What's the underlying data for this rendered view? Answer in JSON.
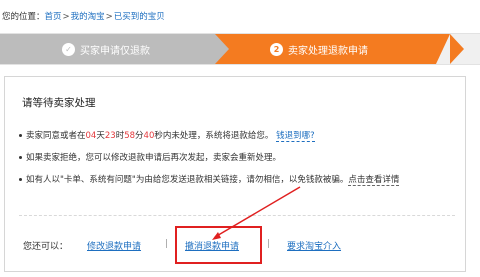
{
  "breadcrumb": {
    "prefix": "您的位置：",
    "items": [
      "首页",
      "我的淘宝",
      "已买到的宝贝"
    ],
    "separator": ">"
  },
  "steps": [
    {
      "label": "买家申请仅退款",
      "icon": "✓",
      "state": "done"
    },
    {
      "label": "卖家处理退款申请",
      "icon": "2",
      "state": "active"
    }
  ],
  "panel": {
    "title": "请等待卖家处理",
    "line1": {
      "prefix": "卖家同意或者在",
      "days": "04",
      "d_unit": "天",
      "hours": "23",
      "h_unit": "时",
      "minutes": "58",
      "m_unit": "分",
      "seconds": "40",
      "s_unit": "秒",
      "suffix": "内未处理，系统将退款给您。",
      "link": "钱退到哪?"
    },
    "line2": "如果卖家拒绝，您可以修改退款申请后再次发起，卖家会重新处理。",
    "line3": {
      "text": "如有人以\"卡单、系统有问题\"为由给您发送退款相关链接，请勿相信，以免钱款被骗。",
      "link": "点击查看详情"
    }
  },
  "actions": {
    "label": "您还可以：",
    "modify": "修改退款申请",
    "cancel": "撤消退款申请",
    "intervene": "要求淘宝介入",
    "separator": "|"
  },
  "colors": {
    "accent": "#f47b20",
    "done": "#bcbcbc",
    "link": "#1e6fc0",
    "highlight": "#e02020"
  }
}
